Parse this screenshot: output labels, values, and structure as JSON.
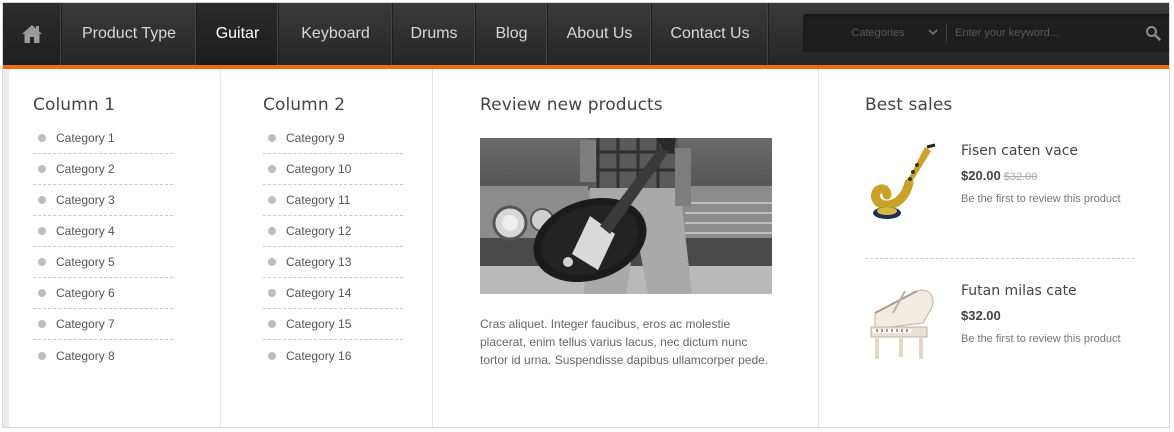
{
  "nav": {
    "items": [
      {
        "label": "Product Type"
      },
      {
        "label": "Guitar"
      },
      {
        "label": "Keyboard"
      },
      {
        "label": "Drums"
      },
      {
        "label": "Blog"
      },
      {
        "label": "About Us"
      },
      {
        "label": "Contact Us"
      }
    ],
    "active_index": 1,
    "icons": {
      "home": "home-icon",
      "search": "search-icon",
      "dropdown": "chevron-down-icon"
    }
  },
  "search": {
    "category_label": "Categories",
    "placeholder": "Enter your keyword..."
  },
  "columns": [
    {
      "title": "Column 1",
      "items": [
        "Category 1",
        "Category 2",
        "Category 3",
        "Category 4",
        "Category 5",
        "Category 6",
        "Category 7",
        "Category 8"
      ]
    },
    {
      "title": "Column 2",
      "items": [
        "Category 9",
        "Category 10",
        "Category 11",
        "Category 12",
        "Category 13",
        "Category 14",
        "Category 15",
        "Category 16"
      ]
    }
  ],
  "review": {
    "title": "Review new products",
    "text": "Cras aliquet. Integer faucibus, eros ac molestie placerat, enim tellus varius lacus, nec dictum nunc tortor id urna. Suspendisse dapibus ullamcorper pede."
  },
  "best_sales": {
    "title": "Best sales",
    "products": [
      {
        "name": "Fisen caten vace",
        "price": "$20.00",
        "old_price": "$32.00",
        "review_link": "Be the first to review this product",
        "image": "saxophone"
      },
      {
        "name": "Futan milas cate",
        "price": "$32.00",
        "old_price": "",
        "review_link": "Be the first to review this product",
        "image": "grand-piano"
      }
    ]
  },
  "colors": {
    "accent": "#ee6a14",
    "nav_bg": "#2f2f2f",
    "text": "#555555"
  }
}
